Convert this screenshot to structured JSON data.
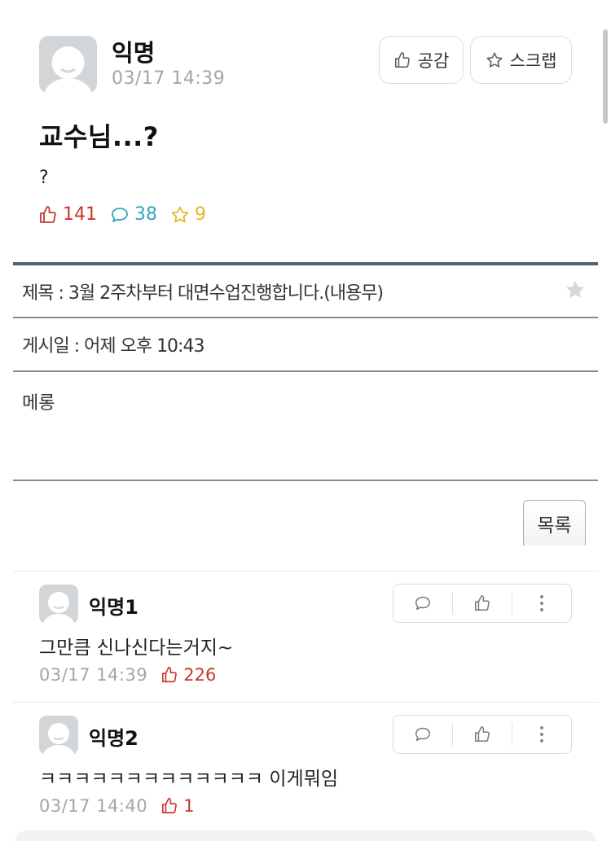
{
  "post": {
    "author": "익명",
    "time": "03/17 14:39",
    "like_button": "공감",
    "scrap_button": "스크랩",
    "title": "교수님...?",
    "body": "?",
    "likes": "141",
    "comments": "38",
    "scraps": "9"
  },
  "notice": {
    "subject": "제목 : 3월 2주차부터 대면수업진행합니다.(내용무)",
    "posted": "게시일 : 어제 오후 10:43",
    "content": "메롱",
    "list_button": "목록"
  },
  "comments": [
    {
      "author": "익명1",
      "text": "그만큼 신나신다는거지~",
      "time": "03/17 14:39",
      "likes": "226"
    },
    {
      "author": "익명2",
      "text": "ㅋㅋㅋㅋㅋㅋㅋㅋㅋㅋㅋㅋㅋ 이게뭐임",
      "time": "03/17 14:40",
      "likes": "1"
    }
  ],
  "colors": {
    "like": "#c8372d",
    "comment": "#33a5bd",
    "scrap": "#e6b726",
    "muted": "#a5a5a5"
  }
}
